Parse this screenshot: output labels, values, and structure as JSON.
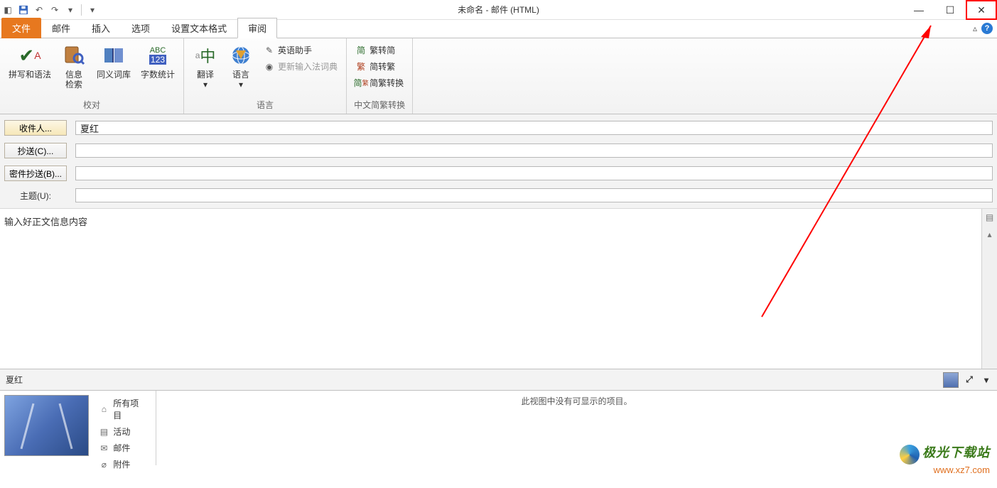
{
  "title": "未命名 - 邮件 (HTML)",
  "tabs": {
    "file": "文件",
    "mail": "邮件",
    "insert": "插入",
    "options": "选项",
    "format": "设置文本格式",
    "review": "审阅"
  },
  "ribbon": {
    "group_proof": "校对",
    "group_lang": "语言",
    "group_cjk": "中文简繁转换",
    "spelling": "拼写和语法",
    "research": "信息\n检索",
    "thesaurus": "同义词库",
    "wordcount": "字数统计",
    "translate": "翻译",
    "language": "语言",
    "eng_assist": "英语助手",
    "update_ime": "更新输入法词典",
    "tc2sc": "繁转简",
    "sc2tc": "简转繁",
    "cjk_conv": "简繁转换"
  },
  "fields": {
    "to_btn": "收件人...",
    "to_value": "夏红",
    "cc_btn": "抄送(C)...",
    "cc_value": "",
    "bcc_btn": "密件抄送(B)...",
    "bcc_value": "",
    "subject_label": "主题(U):",
    "subject_value": ""
  },
  "body_text": "输入好正文信息内容",
  "people": {
    "header_name": "夏红",
    "all_items": "所有项目",
    "activity": "活动",
    "mail": "邮件",
    "attachments": "附件",
    "empty_msg": "此视图中没有可显示的项目。"
  },
  "watermark": {
    "title": "极光下载站",
    "url": "www.xz7.com"
  }
}
